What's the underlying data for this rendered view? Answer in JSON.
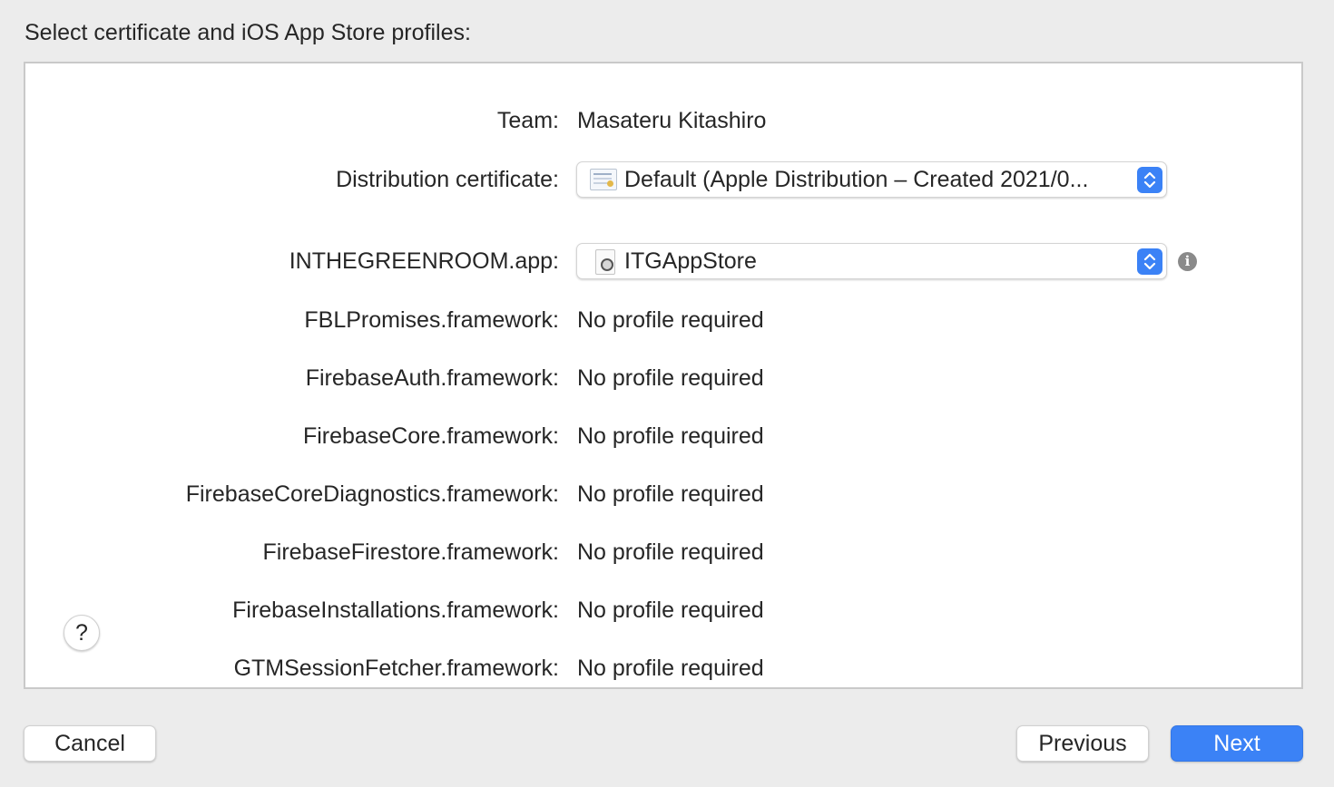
{
  "header": {
    "title": "Select certificate and iOS App Store profiles:"
  },
  "team": {
    "label": "Team:",
    "value": "Masateru Kitashiro"
  },
  "certificate": {
    "label": "Distribution certificate:",
    "selected": "Default (Apple Distribution – Created 2021/0..."
  },
  "app": {
    "label": "INTHEGREENROOM.app:",
    "selected": "ITGAppStore"
  },
  "frameworks": [
    {
      "label": "FBLPromises.framework:",
      "value": "No profile required"
    },
    {
      "label": "FirebaseAuth.framework:",
      "value": "No profile required"
    },
    {
      "label": "FirebaseCore.framework:",
      "value": "No profile required"
    },
    {
      "label": "FirebaseCoreDiagnostics.framework:",
      "value": "No profile required"
    },
    {
      "label": "FirebaseFirestore.framework:",
      "value": "No profile required"
    },
    {
      "label": "FirebaseInstallations.framework:",
      "value": "No profile required"
    },
    {
      "label": "GTMSessionFetcher.framework:",
      "value": "No profile required"
    }
  ],
  "help": {
    "label": "?"
  },
  "info": {
    "label": "i"
  },
  "footer": {
    "cancel_label": "Cancel",
    "previous_label": "Previous",
    "next_label": "Next"
  },
  "colors": {
    "accent": "#3b82f6",
    "background": "#ececec",
    "panel": "#ffffff"
  },
  "icons": {
    "certificate": "certificate-icon",
    "app": "app-icon",
    "info": "info-icon",
    "stepper": "chevron-up-down-icon",
    "help": "help-icon"
  }
}
